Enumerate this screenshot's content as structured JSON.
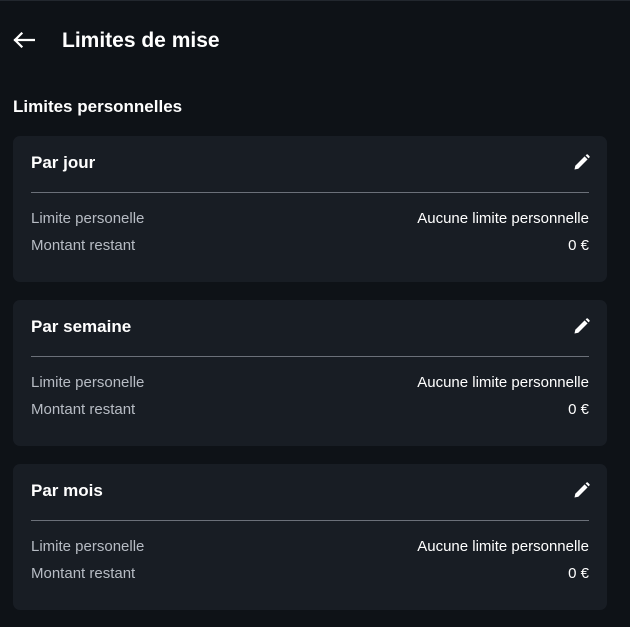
{
  "header": {
    "back_icon": "arrow-left-icon",
    "title": "Limites de mise"
  },
  "section": {
    "title": "Limites personnelles"
  },
  "cards": [
    {
      "title": "Par jour",
      "edit_icon": "pencil-icon",
      "rows": [
        {
          "label": "Limite personelle",
          "value": "Aucune limite personnelle"
        },
        {
          "label": "Montant restant",
          "value": "0 €"
        }
      ]
    },
    {
      "title": "Par semaine",
      "edit_icon": "pencil-icon",
      "rows": [
        {
          "label": "Limite personelle",
          "value": "Aucune limite personnelle"
        },
        {
          "label": "Montant restant",
          "value": "0 €"
        }
      ]
    },
    {
      "title": "Par mois",
      "edit_icon": "pencil-icon",
      "rows": [
        {
          "label": "Limite personelle",
          "value": "Aucune limite personnelle"
        },
        {
          "label": "Montant restant",
          "value": "0 €"
        }
      ]
    }
  ],
  "colors": {
    "background": "#0e1217",
    "card": "#181d24",
    "label": "#b7bcc4",
    "text": "#ffffff",
    "divider": "#6b7079"
  }
}
